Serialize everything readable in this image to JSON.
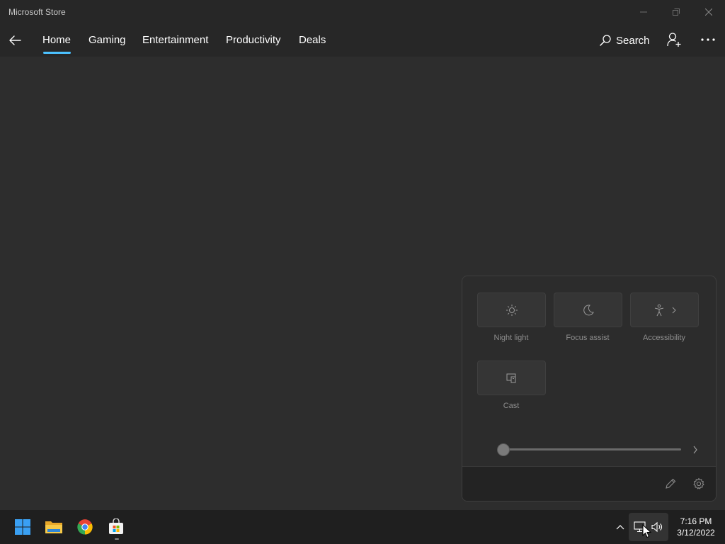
{
  "window": {
    "title": "Microsoft Store",
    "controls": [
      "minimize-icon",
      "restore-icon",
      "close-icon"
    ]
  },
  "nav": {
    "back_icon": "back-arrow-icon",
    "tabs": [
      {
        "label": "Home",
        "active": true
      },
      {
        "label": "Gaming",
        "active": false
      },
      {
        "label": "Entertainment",
        "active": false
      },
      {
        "label": "Productivity",
        "active": false
      },
      {
        "label": "Deals",
        "active": false
      }
    ],
    "search_label": "Search",
    "account_icon": "add-user-icon",
    "more_icon": "more-icon"
  },
  "quick_settings": {
    "tiles": [
      {
        "label": "Night light",
        "icon": "night-light-icon"
      },
      {
        "label": "Focus assist",
        "icon": "moon-icon"
      },
      {
        "label": "Accessibility",
        "icon": "accessibility-icon"
      },
      {
        "label": "Cast",
        "icon": "cast-icon"
      }
    ],
    "brightness_level": 0,
    "footer_icons": [
      "edit-pencil-icon",
      "settings-gear-icon"
    ]
  },
  "taskbar": {
    "apps": [
      "start-icon",
      "file-explorer-icon",
      "chrome-icon",
      "microsoft-store-icon"
    ],
    "tray_icons": [
      "chevron-up-icon",
      "network-icon",
      "volume-icon"
    ],
    "clock": {
      "time": "7:16 PM",
      "date": "3/12/2022"
    }
  },
  "colors": {
    "accent": "#4cc2ff",
    "background": "#2b2b2b",
    "taskbar": "#1f1f1f"
  }
}
